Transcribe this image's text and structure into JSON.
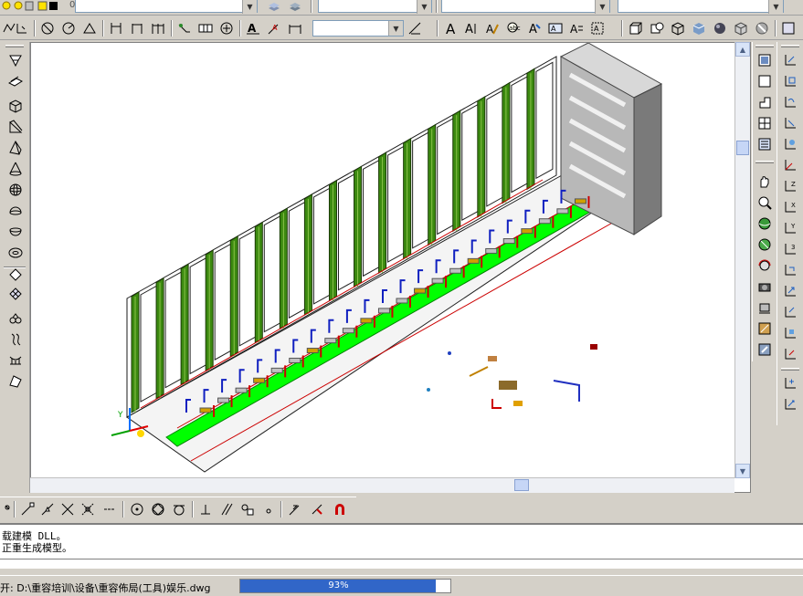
{
  "command_line": {
    "line1": "载建模 DLL。",
    "line2": "正重生成模型。"
  },
  "status_bar": {
    "file_text": "开: D:\\重容培训\\设备\\重容佈局(工具)娱乐.dwg",
    "progress_percent": 93,
    "progress_label": "93%"
  },
  "top_toolbar": {
    "layer_value": "0"
  },
  "colors": {
    "app_bg": "#d4d0c8",
    "canvas_bg": "#ffffff",
    "progress_fill": "#3166c8",
    "highlight_green": "#00ff00",
    "building_gray": "#a8a8a8"
  },
  "icons": {
    "draw_toolbar": [
      "polyline-icon",
      "line-icon",
      "xline-icon",
      "dimension-icon",
      "circle-icon",
      "block-icon",
      "rotate-icon",
      "perpendicular-icon",
      "parallel-icon",
      "insert-icon",
      "node-icon",
      "snap-icon",
      "eraser-icon",
      "magnet-icon"
    ],
    "top_row_2": [
      "ucs-icon",
      "angle-icon",
      "circle-dim-icon",
      "triangle-icon",
      "text-a-icon",
      "text-style-icon",
      "multitext-icon",
      "render-icon",
      "shade-icon",
      "cube-icon",
      "sphere-icon"
    ]
  }
}
